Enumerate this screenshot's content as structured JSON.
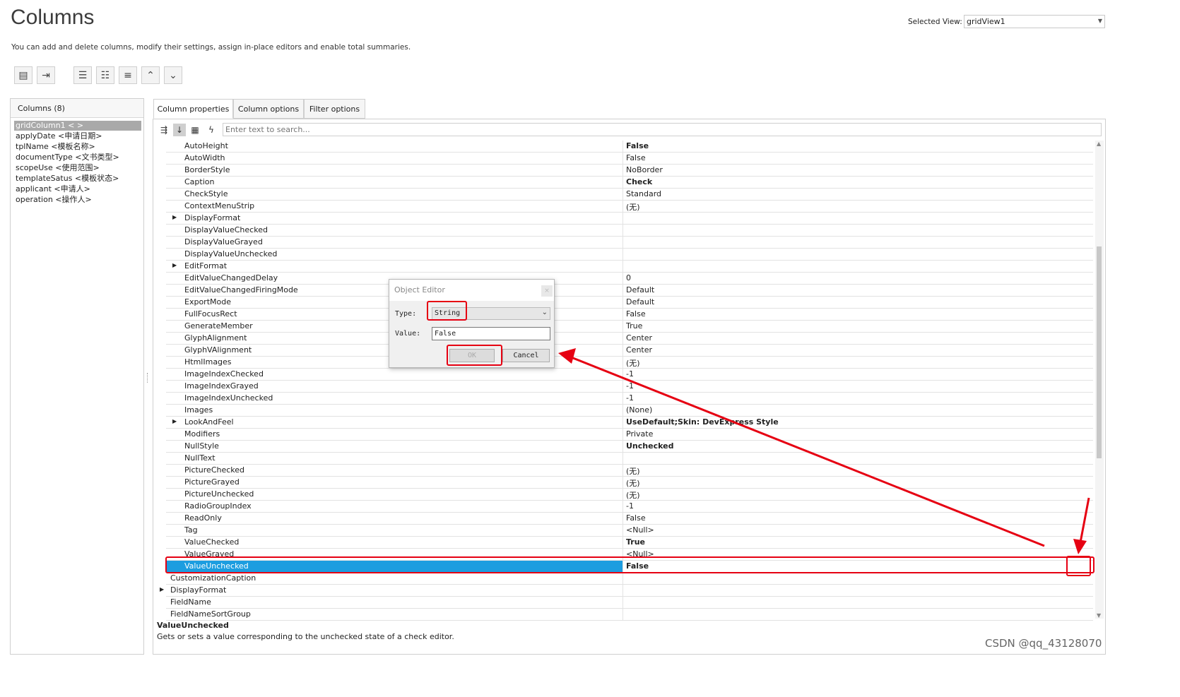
{
  "header": {
    "title": "Columns",
    "subtitle": "You can add and delete columns, modify their settings, assign in-place editors and enable total summaries.",
    "selected_view_label": "Selected View:",
    "selected_view_value": "gridView1"
  },
  "toolbar": {
    "buttons": [
      "add-column-icon",
      "retrieve-fields-icon",
      "insert-column-icon",
      "add-child-icon",
      "remove-column-icon",
      "move-up-icon",
      "move-down-icon"
    ]
  },
  "columns_panel": {
    "header": "Columns (8)",
    "items": [
      "gridColumn1 < >",
      "applyDate <申请日期>",
      "tplName <模板名称>",
      "documentType <文书类型>",
      "scopeUse <使用范围>",
      "templateSatus <模板状态>",
      "applicant <申请人>",
      "operation <操作人>"
    ]
  },
  "tabs": [
    "Column properties",
    "Column options",
    "Filter options"
  ],
  "search": {
    "placeholder": "Enter text to search..."
  },
  "properties": [
    {
      "name": "AutoHeight",
      "value": "False",
      "bold": true
    },
    {
      "name": "AutoWidth",
      "value": "False"
    },
    {
      "name": "BorderStyle",
      "value": "NoBorder"
    },
    {
      "name": "Caption",
      "value": "Check",
      "bold": true
    },
    {
      "name": "CheckStyle",
      "value": "Standard"
    },
    {
      "name": "ContextMenuStrip",
      "value": "(无)"
    },
    {
      "name": "DisplayFormat",
      "value": "",
      "expandable": true
    },
    {
      "name": "DisplayValueChecked",
      "value": ""
    },
    {
      "name": "DisplayValueGrayed",
      "value": ""
    },
    {
      "name": "DisplayValueUnchecked",
      "value": ""
    },
    {
      "name": "EditFormat",
      "value": "",
      "expandable": true
    },
    {
      "name": "EditValueChangedDelay",
      "value": "0"
    },
    {
      "name": "EditValueChangedFiringMode",
      "value": "Default"
    },
    {
      "name": "ExportMode",
      "value": "Default"
    },
    {
      "name": "FullFocusRect",
      "value": "False"
    },
    {
      "name": "GenerateMember",
      "value": "True"
    },
    {
      "name": "GlyphAlignment",
      "value": "Center"
    },
    {
      "name": "GlyphVAlignment",
      "value": "Center"
    },
    {
      "name": "HtmlImages",
      "value": "(无)"
    },
    {
      "name": "ImageIndexChecked",
      "value": "-1"
    },
    {
      "name": "ImageIndexGrayed",
      "value": "-1"
    },
    {
      "name": "ImageIndexUnchecked",
      "value": "-1"
    },
    {
      "name": "Images",
      "value": "(None)"
    },
    {
      "name": "LookAndFeel",
      "value": "UseDefault;Skin: DevExpress Style",
      "bold": true,
      "expandable": true
    },
    {
      "name": "Modifiers",
      "value": "Private"
    },
    {
      "name": "NullStyle",
      "value": "Unchecked",
      "bold": true
    },
    {
      "name": "NullText",
      "value": ""
    },
    {
      "name": "PictureChecked",
      "value": "(无)"
    },
    {
      "name": "PictureGrayed",
      "value": "(无)"
    },
    {
      "name": "PictureUnchecked",
      "value": "(无)"
    },
    {
      "name": "RadioGroupIndex",
      "value": "-1"
    },
    {
      "name": "ReadOnly",
      "value": "False"
    },
    {
      "name": "Tag",
      "value": "<Null>"
    },
    {
      "name": "ValueChecked",
      "value": "True",
      "bold": true
    },
    {
      "name": "ValueGrayed",
      "value": "<Null>"
    },
    {
      "name": "ValueUnchecked",
      "value": "False",
      "bold": true,
      "selected": true
    },
    {
      "name": "CustomizationCaption",
      "value": "",
      "level0": true
    },
    {
      "name": "DisplayFormat",
      "value": "",
      "level0": true,
      "expandable": true
    },
    {
      "name": "FieldName",
      "value": "",
      "level0": true
    },
    {
      "name": "FieldNameSortGroup",
      "value": "",
      "level0": true
    }
  ],
  "description": {
    "name": "ValueUnchecked",
    "text": "Gets or sets a value corresponding to the unchecked state of a check editor."
  },
  "dialog": {
    "title": "Object Editor",
    "type_label": "Type:",
    "type_value": "String",
    "value_label": "Value:",
    "value_value": "False",
    "ok_label": "OK",
    "cancel_label": "Cancel",
    "close_glyph": "×"
  },
  "watermark": "CSDN @qq_43128070",
  "colors": {
    "selection": "#1c9de0",
    "annotation": "#e60012"
  }
}
